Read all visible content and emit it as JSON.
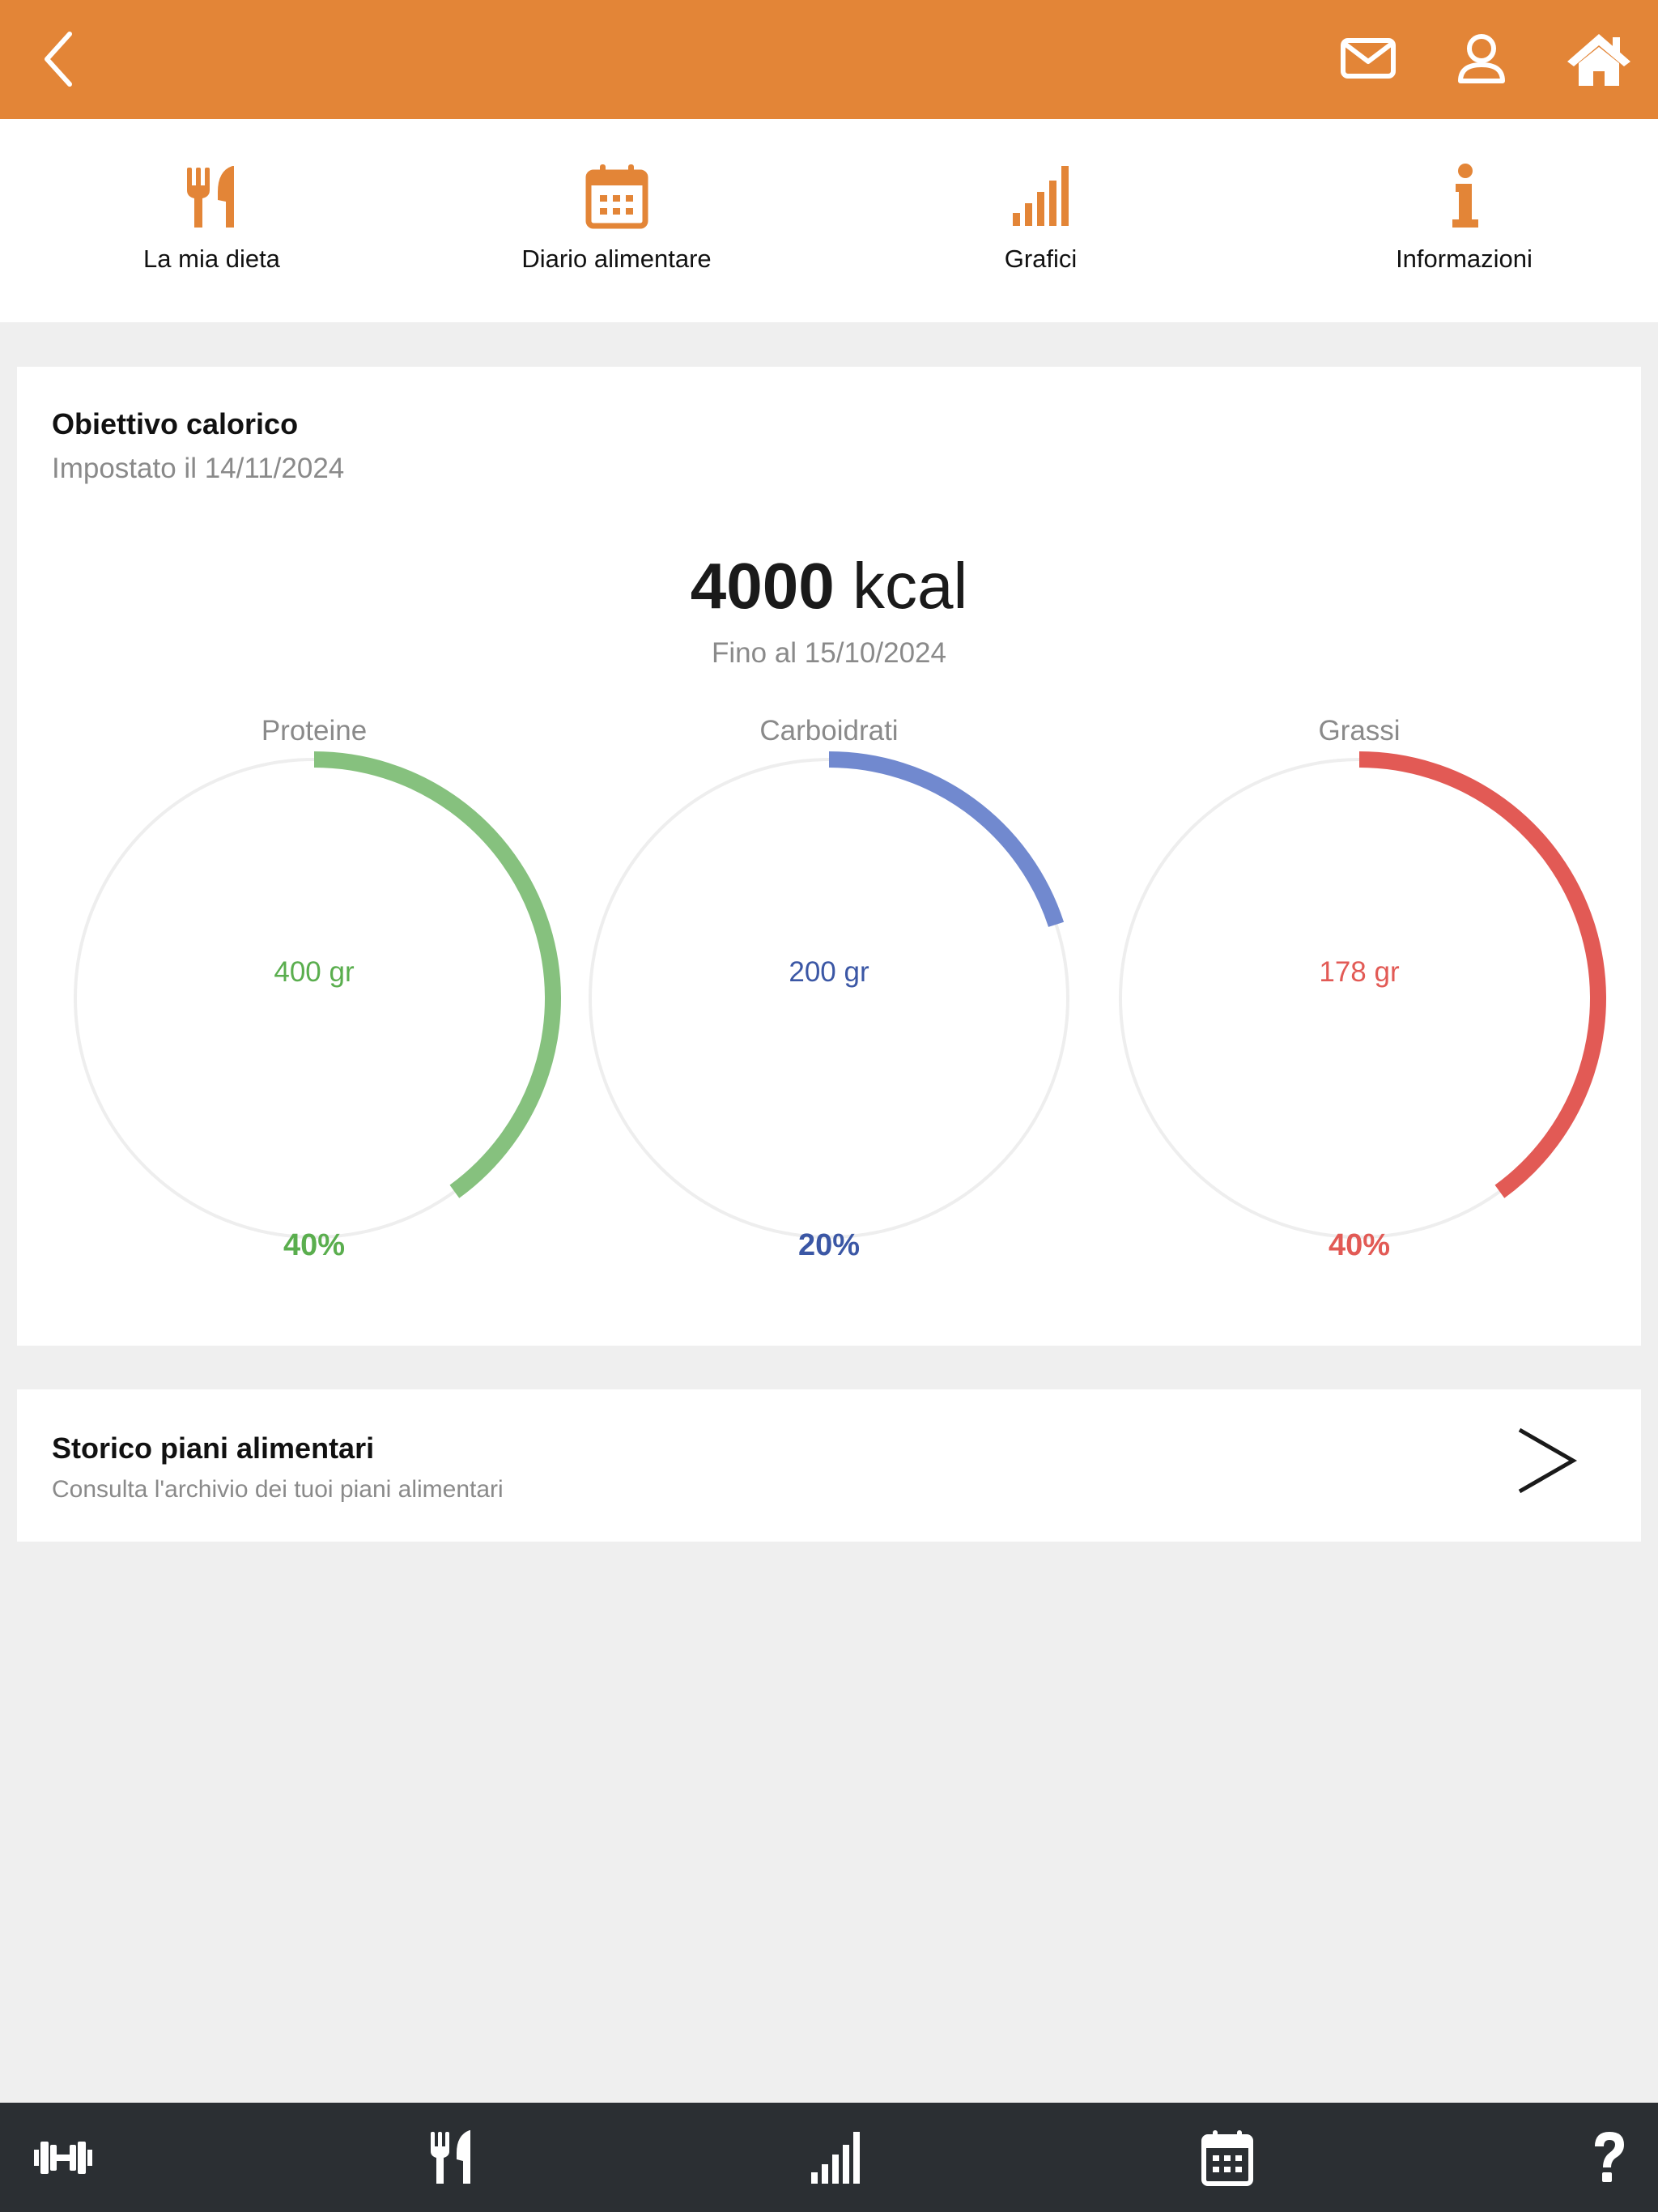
{
  "topbar": {
    "background": "#e38537",
    "icons": [
      "chevron-left-icon",
      "envelope-icon",
      "user-icon",
      "home-icon"
    ]
  },
  "subnav": {
    "accent": "#e38537",
    "items": [
      {
        "label": "La mia dieta",
        "icon": "fork-knife-icon"
      },
      {
        "label": "Diario alimentare",
        "icon": "calendar-icon"
      },
      {
        "label": "Grafici",
        "icon": "signal-bars-icon"
      },
      {
        "label": "Informazioni",
        "icon": "info-icon"
      }
    ]
  },
  "goal": {
    "title": "Obiettivo calorico",
    "set_on": "Impostato il 14/11/2024",
    "kcal_value": "4000",
    "kcal_unit": "kcal",
    "until": "Fino al 15/10/2024",
    "macros": [
      {
        "name": "Proteine",
        "grams": "400 gr",
        "percent_label": "40%",
        "percent": 40,
        "color": "#86c17e",
        "text_color": "#5aae4e"
      },
      {
        "name": "Carboidrati",
        "grams": "200 gr",
        "percent_label": "20%",
        "percent": 20,
        "color": "#7189cf",
        "text_color": "#3b57a5"
      },
      {
        "name": "Grassi",
        "grams": "178 gr",
        "percent_label": "40%",
        "percent": 40,
        "color": "#e25a55",
        "text_color": "#e25a55"
      }
    ]
  },
  "history": {
    "title": "Storico piani alimentari",
    "subtitle": "Consulta l'archivio dei tuoi piani alimentari"
  },
  "tabbar": {
    "background": "#2b2f33",
    "icons": [
      "dumbbell-icon",
      "fork-knife-icon",
      "signal-bars-icon",
      "calendar-icon",
      "question-icon"
    ]
  }
}
